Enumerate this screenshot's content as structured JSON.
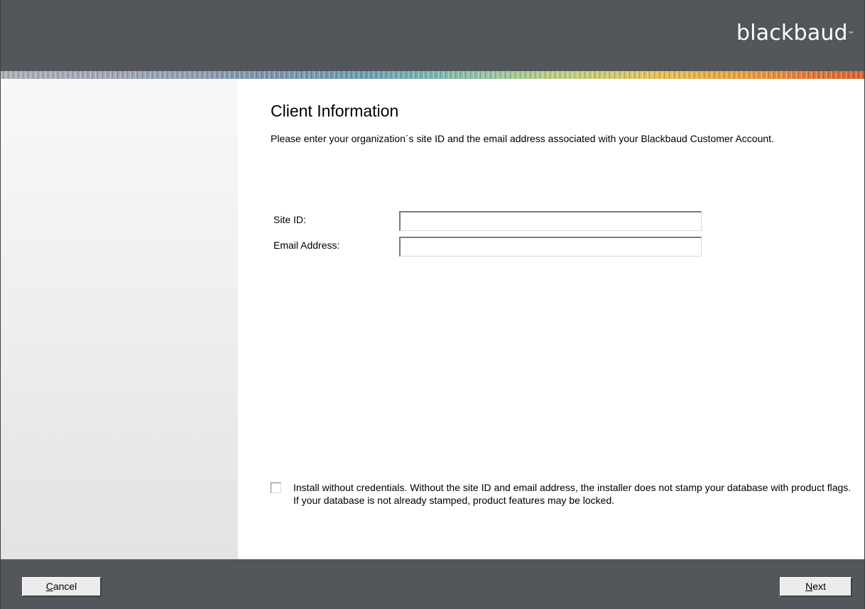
{
  "header": {
    "logo_text": "blackbaud",
    "logo_mark": "™"
  },
  "page": {
    "title": "Client Information",
    "description": "Please enter your organization´s site ID and the email address associated with your Blackbaud Customer Account."
  },
  "form": {
    "site_id_label": "Site ID:",
    "site_id_value": "",
    "email_label": "Email Address:",
    "email_value": ""
  },
  "install_option": {
    "checked": false,
    "text": "Install without credentials. Without the site ID and email address, the installer does not stamp your database with product flags. If your database is not already stamped, product features may be locked."
  },
  "footer": {
    "cancel_access_key": "C",
    "cancel_rest": "ancel",
    "next_access_key": "N",
    "next_rest": "ext"
  },
  "colors": {
    "chrome": "#53565a",
    "sidebar": "#ececec",
    "stripe_start": "#aeb1b8",
    "stripe_end": "#d8652f"
  }
}
